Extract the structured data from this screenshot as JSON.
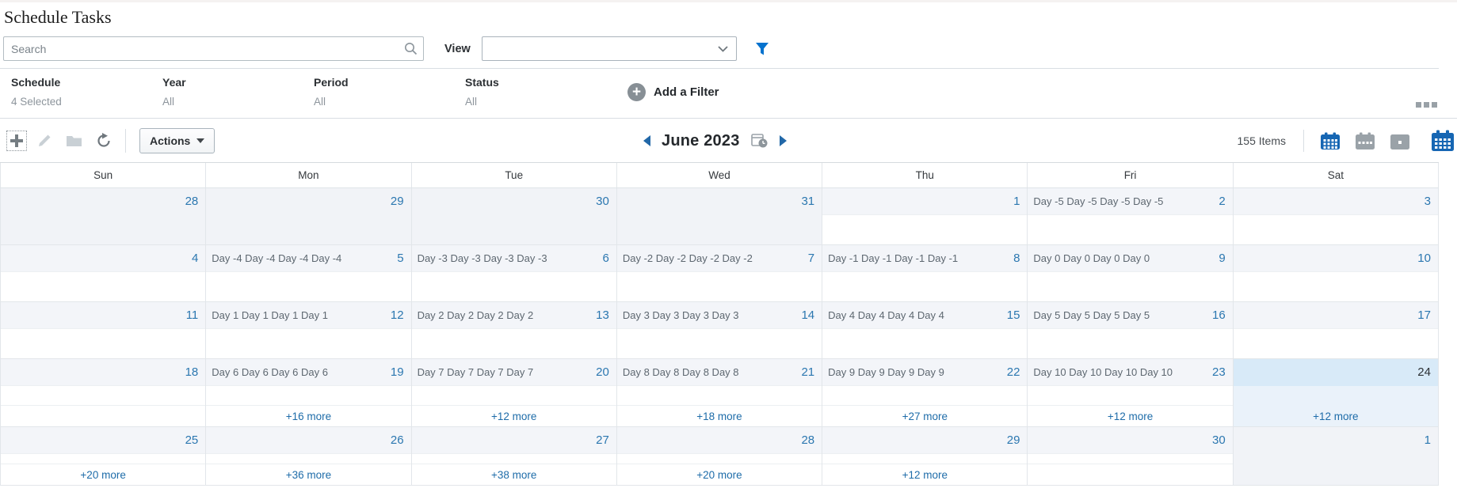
{
  "colors": {
    "accent_blue": "#0572ce",
    "date_blue": "#2b77b0",
    "link_blue": "#1e6ca9",
    "selected_day_bg": "#d8eaf8",
    "date_band_bg": "#f3f5f9",
    "out_of_month_bg": "#f1f3f7"
  },
  "icons": {
    "search": "magnifier-glyph",
    "filter": "blue-funnel",
    "add": "plus",
    "edit": "pencil",
    "folder": "folder",
    "refresh": "circular-arrow",
    "prev": "left-triangle",
    "next": "right-triangle",
    "date_picker": "calendar-with-clock",
    "month_view": "calendar-grid-blue",
    "week_view": "calendar-row-gray",
    "day_view": "calendar-dot-gray",
    "calendar_big": "large-calendar-blue",
    "overflow": "three-squares"
  },
  "page": {
    "title": "Schedule Tasks"
  },
  "search": {
    "placeholder": "Search"
  },
  "view": {
    "label": "View",
    "selected": ""
  },
  "filters": {
    "fields": [
      {
        "label": "Schedule",
        "value": "4 Selected"
      },
      {
        "label": "Year",
        "value": "All"
      },
      {
        "label": "Period",
        "value": "All"
      },
      {
        "label": "Status",
        "value": "All"
      }
    ],
    "add_label": "Add a Filter"
  },
  "toolbar": {
    "actions_label": "Actions",
    "period_label": "June 2023",
    "items_count": "155 Items"
  },
  "calendar": {
    "day_headers": [
      "Sun",
      "Mon",
      "Tue",
      "Wed",
      "Thu",
      "Fri",
      "Sat"
    ],
    "weeks": [
      [
        {
          "date": "28",
          "out": true
        },
        {
          "date": "29",
          "out": true
        },
        {
          "date": "30",
          "out": true
        },
        {
          "date": "31",
          "out": true
        },
        {
          "date": "1"
        },
        {
          "date": "2",
          "event": "Day -5 Day -5 Day -5 Day -5"
        },
        {
          "date": "3"
        }
      ],
      [
        {
          "date": "4"
        },
        {
          "date": "5",
          "event": "Day -4 Day -4 Day -4 Day -4"
        },
        {
          "date": "6",
          "event": "Day -3 Day -3 Day -3 Day -3"
        },
        {
          "date": "7",
          "event": "Day -2 Day -2 Day -2 Day -2"
        },
        {
          "date": "8",
          "event": "Day -1 Day -1 Day -1 Day -1"
        },
        {
          "date": "9",
          "event": "Day 0 Day 0 Day 0 Day 0"
        },
        {
          "date": "10"
        }
      ],
      [
        {
          "date": "11"
        },
        {
          "date": "12",
          "event": "Day 1 Day 1 Day 1 Day 1"
        },
        {
          "date": "13",
          "event": "Day 2 Day 2 Day 2 Day 2"
        },
        {
          "date": "14",
          "event": "Day 3 Day 3 Day 3 Day 3"
        },
        {
          "date": "15",
          "event": "Day 4 Day 4 Day 4 Day 4"
        },
        {
          "date": "16",
          "event": "Day 5 Day 5 Day 5 Day 5"
        },
        {
          "date": "17"
        }
      ],
      [
        {
          "date": "18"
        },
        {
          "date": "19",
          "event": "Day 6 Day 6 Day 6 Day 6",
          "more": "+16 more"
        },
        {
          "date": "20",
          "event": "Day 7 Day 7 Day 7 Day 7",
          "more": "+12 more"
        },
        {
          "date": "21",
          "event": "Day 8 Day 8 Day 8 Day 8",
          "more": "+18 more"
        },
        {
          "date": "22",
          "event": "Day 9 Day 9 Day 9 Day 9",
          "more": "+27 more"
        },
        {
          "date": "23",
          "event": "Day 10 Day 10 Day 10 Day 10",
          "more": "+12 more"
        },
        {
          "date": "24",
          "selected": true,
          "more": "+12 more"
        }
      ],
      [
        {
          "date": "25",
          "more": "+20 more"
        },
        {
          "date": "26",
          "more": "+36 more"
        },
        {
          "date": "27",
          "more": "+38 more"
        },
        {
          "date": "28",
          "more": "+20 more"
        },
        {
          "date": "29",
          "more": "+12 more"
        },
        {
          "date": "30"
        },
        {
          "date": "1",
          "out": true
        }
      ]
    ]
  }
}
